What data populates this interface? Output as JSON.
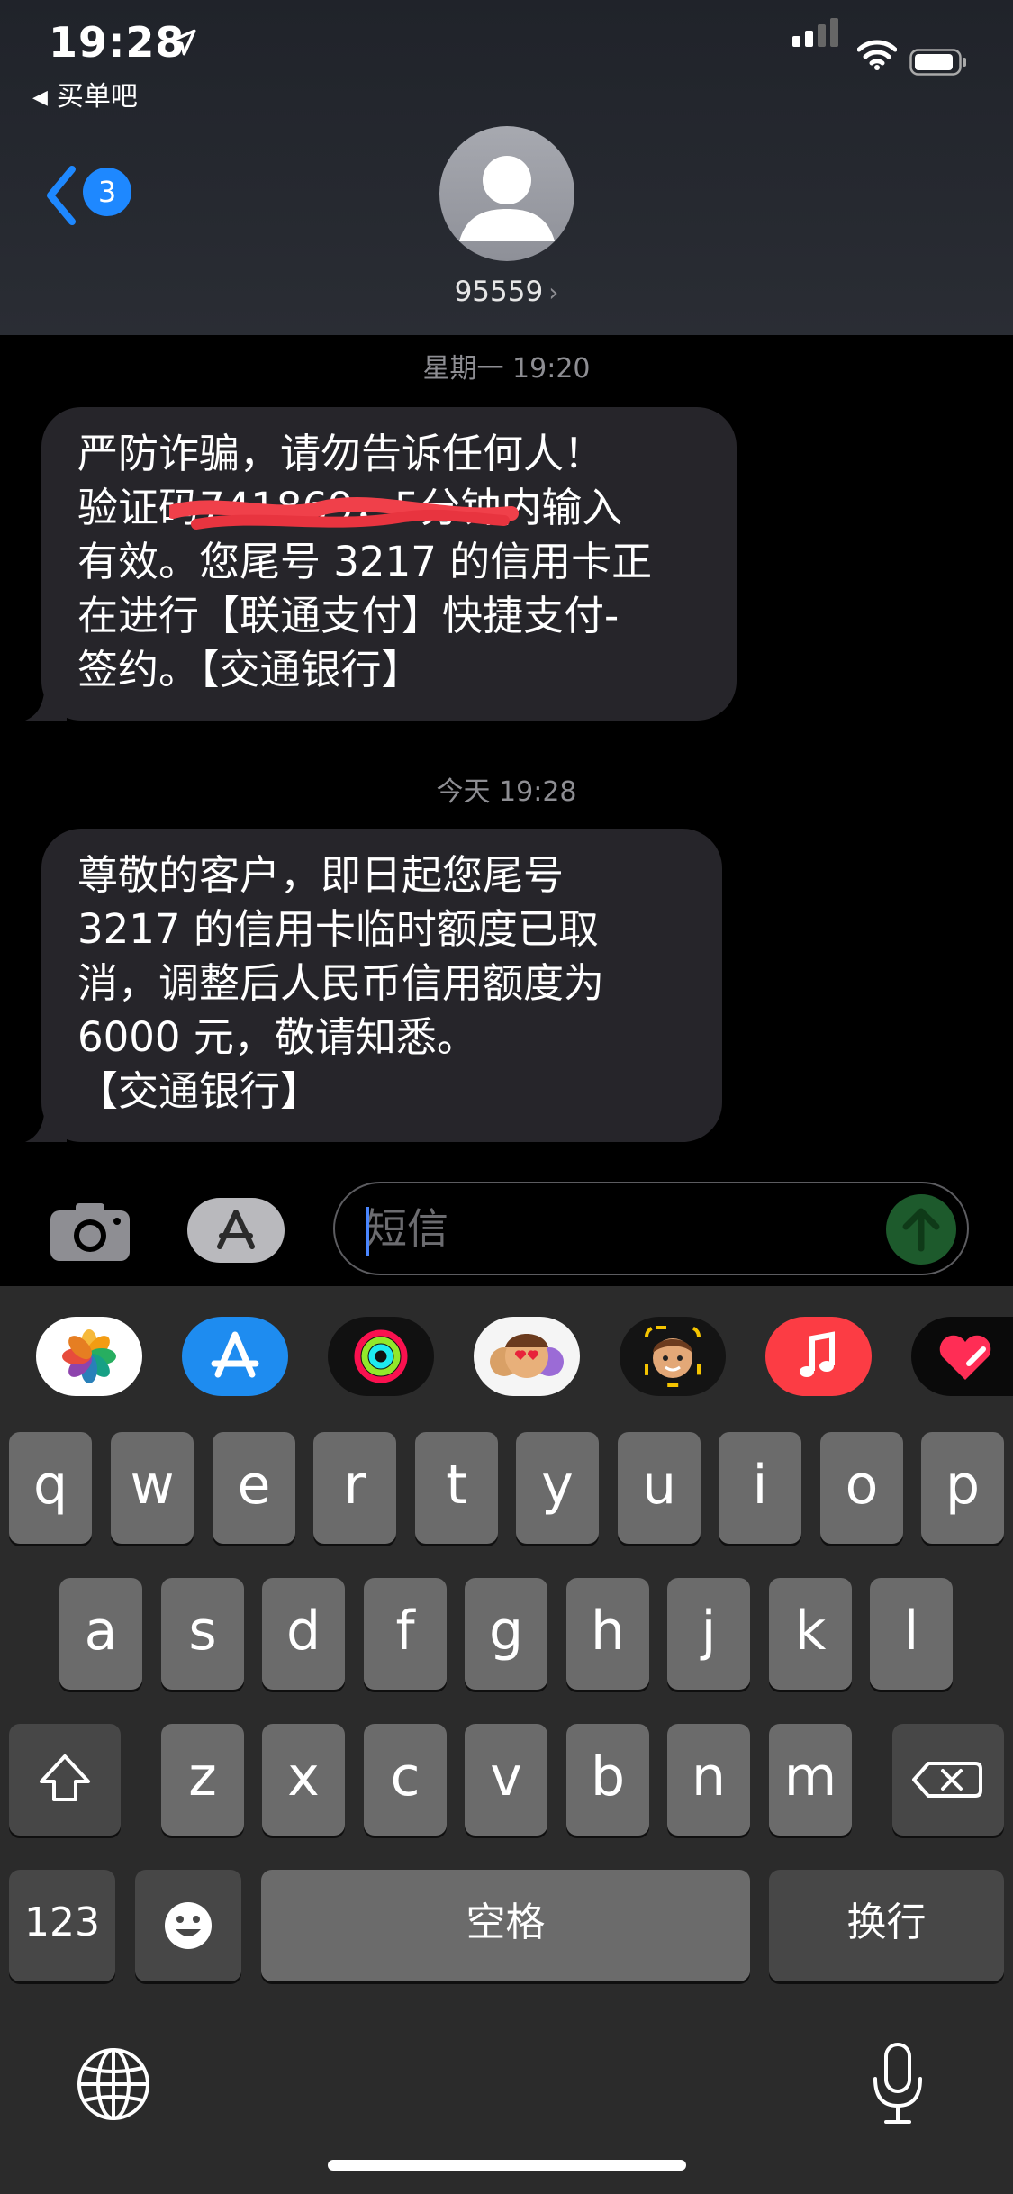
{
  "status_bar": {
    "time": "19:28",
    "back_app": "买单吧"
  },
  "nav": {
    "unread_count": "3",
    "contact": "95559"
  },
  "messages": [
    {
      "timestamp": "星期一 19:20",
      "lines": [
        "严防诈骗，请勿告诉任何人！",
        "验证码741869，5分钟内输入",
        "有效。您尾号 3217 的信用卡正",
        "在进行【联通支付】快捷支付-",
        "签约。【交通银行】"
      ]
    },
    {
      "timestamp": "今天 19:28",
      "lines": [
        "尊敬的客户，即日起您尾号",
        "3217 的信用卡临时额度已取",
        "消，调整后人民币信用额度为",
        "6000 元，敬请知悉。",
        "【交通银行】"
      ]
    }
  ],
  "composer": {
    "placeholder": "短信"
  },
  "app_strip": [
    "photos-icon",
    "app-store-icon",
    "activity-icon",
    "memoji-stickers-icon",
    "memoji-icon",
    "music-icon",
    "digital-touch-icon"
  ],
  "keyboard": {
    "row1": [
      "q",
      "w",
      "e",
      "r",
      "t",
      "y",
      "u",
      "i",
      "o",
      "p"
    ],
    "row2": [
      "a",
      "s",
      "d",
      "f",
      "g",
      "h",
      "j",
      "k",
      "l"
    ],
    "row3": [
      "z",
      "x",
      "c",
      "v",
      "b",
      "n",
      "m"
    ],
    "numbers_label": "123",
    "space_label": "空格",
    "return_label": "换行"
  },
  "colors": {
    "bubble": "#26252a",
    "accent": "#1e88ff",
    "keyboard_bg": "#2b2b2b",
    "key": "#6b6b6b"
  }
}
